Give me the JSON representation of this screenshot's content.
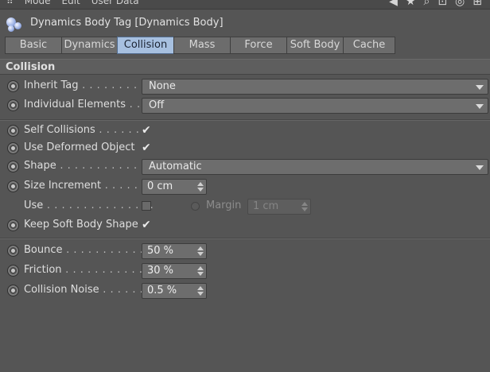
{
  "menubar": {
    "items": [
      "Mode",
      "Edit",
      "User Data"
    ]
  },
  "header": {
    "icon": "dynamics-body-tag-icon",
    "title": "Dynamics Body Tag [Dynamics Body]"
  },
  "tabs": [
    {
      "label": "Basic",
      "active": false
    },
    {
      "label": "Dynamics",
      "active": false
    },
    {
      "label": "Collision",
      "active": true
    },
    {
      "label": "Mass",
      "active": false
    },
    {
      "label": "Force",
      "active": false
    },
    {
      "label": "Soft Body",
      "active": false
    },
    {
      "label": "Cache",
      "active": false
    }
  ],
  "section": {
    "title": "Collision"
  },
  "fields": {
    "inherit_tag": {
      "label": "Inherit Tag",
      "dots": " . . . . . . . . . .",
      "value": "None"
    },
    "individual_elements": {
      "label": "Individual Elements",
      "dots": " . . .",
      "value": "Off"
    },
    "self_collisions": {
      "label": "Self Collisions",
      "dots": " . . . . . . .",
      "checked": true
    },
    "use_deformed_object": {
      "label": "Use Deformed Object",
      "dots": "",
      "checked": true
    },
    "shape": {
      "label": "Shape",
      "dots": " . . . . . . . . . . . . . .",
      "value": "Automatic"
    },
    "size_increment": {
      "label": "Size Increment",
      "dots": " . . . . . . .",
      "value": "0 cm"
    },
    "use": {
      "label": "Use",
      "dots": " . . . . . . . . . . . . . . .",
      "checked": false
    },
    "margin": {
      "label": "Margin",
      "value": "1 cm"
    },
    "keep_soft_body_shape": {
      "label": "Keep Soft Body Shape",
      "dots": "",
      "checked": true
    },
    "bounce": {
      "label": "Bounce",
      "dots": " . . . . . . . . . . . . .",
      "value": "50 %"
    },
    "friction": {
      "label": "Friction",
      "dots": " . . . . . . . . . . . . .",
      "value": "30 %"
    },
    "collision_noise": {
      "label": "Collision Noise",
      "dots": " . . . . . .",
      "value": "0.5 %"
    }
  },
  "colors": {
    "panel_bg": "#555555",
    "active_tab": "#a7c0e0",
    "field_bg": "#6d6d6d"
  }
}
